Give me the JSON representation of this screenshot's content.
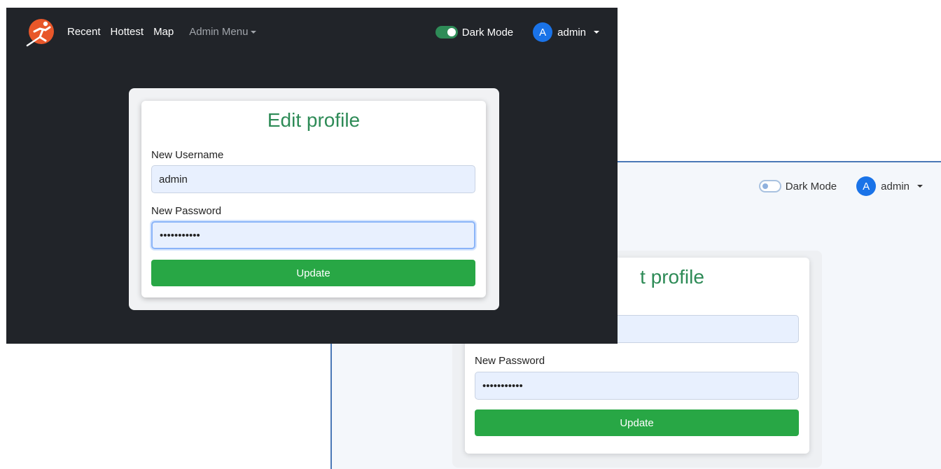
{
  "nav": {
    "links": [
      "Recent",
      "Hottest",
      "Map"
    ],
    "admin_menu": "Admin Menu",
    "dark_mode_label": "Dark Mode",
    "avatar_initial": "A",
    "user_name": "admin"
  },
  "form": {
    "title": "Edit profile",
    "title_partial": "t profile",
    "username_label": "New Username",
    "username_value": "admin",
    "password_label": "New Password",
    "password_value": "•••••••••••",
    "submit_label": "Update"
  },
  "colors": {
    "dark_background": "#212429",
    "light_background": "#f4f7fb",
    "accent_green": "#28a745",
    "title_green": "#2e8b57",
    "avatar_blue": "#1a73e8"
  },
  "icons": {
    "logo": "runner-logo-icon",
    "toggle": "toggle-switch-icon",
    "caret": "caret-down-icon"
  }
}
